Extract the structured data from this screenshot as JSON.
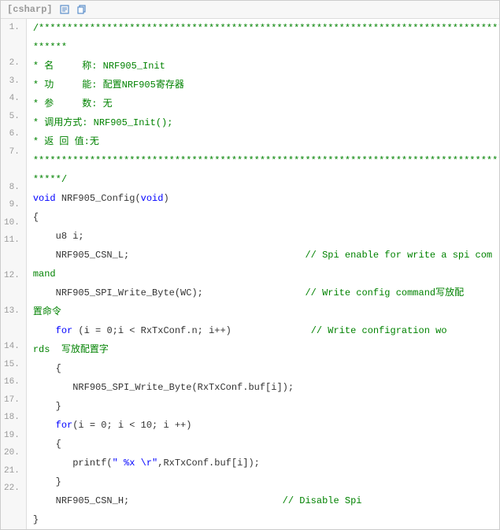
{
  "lang": "[csharp]",
  "icons": {
    "view": "view-plain-icon",
    "copy": "copy-icon"
  },
  "lines": [
    {
      "n": "1.",
      "segments": [
        {
          "cls": "c-comment",
          "t": "/************************************************************************************"
        }
      ]
    },
    {
      "cont": true,
      "segments": [
        {
          "cls": "c-comment",
          "t": "******"
        }
      ]
    },
    {
      "n": "2.",
      "segments": [
        {
          "cls": "c-comment",
          "t": "* 名     称: NRF905_Init"
        }
      ]
    },
    {
      "n": "3.",
      "segments": [
        {
          "cls": "c-comment",
          "t": "* 功     能: 配置NRF905寄存器"
        }
      ]
    },
    {
      "n": "4.",
      "segments": [
        {
          "cls": "c-comment",
          "t": "* 参     数: 无"
        }
      ]
    },
    {
      "n": "5.",
      "segments": [
        {
          "cls": "c-comment",
          "t": "* 调用方式: NRF905_Init();"
        }
      ]
    },
    {
      "n": "6.",
      "segments": [
        {
          "cls": "c-comment",
          "t": "* 返 回 值:无"
        }
      ]
    },
    {
      "n": "7.",
      "segments": [
        {
          "cls": "c-comment",
          "t": "*************************************************************************************"
        }
      ]
    },
    {
      "cont": true,
      "segments": [
        {
          "cls": "c-comment",
          "t": "*****/"
        }
      ]
    },
    {
      "n": "8.",
      "segments": [
        {
          "cls": "c-keyword",
          "t": "void"
        },
        {
          "t": " NRF905_Config("
        },
        {
          "cls": "c-keyword",
          "t": "void"
        },
        {
          "t": ")  "
        }
      ]
    },
    {
      "n": "9.",
      "segments": [
        {
          "t": "{  "
        }
      ]
    },
    {
      "n": "10.",
      "segments": [
        {
          "t": "    u8 i;  "
        }
      ]
    },
    {
      "n": "11.",
      "segments": [
        {
          "t": "    NRF905_CSN_L;                               "
        },
        {
          "cls": "c-comment",
          "t": "// Spi enable for write a spi com"
        }
      ]
    },
    {
      "cont": true,
      "segments": [
        {
          "cls": "c-comment",
          "t": "mand  "
        }
      ]
    },
    {
      "n": "12.",
      "segments": [
        {
          "t": "    NRF905_SPI_Write_Byte(WC);                  "
        },
        {
          "cls": "c-comment",
          "t": "// Write config command写放配"
        }
      ]
    },
    {
      "cont": true,
      "segments": [
        {
          "cls": "c-comment",
          "t": "置命令  "
        }
      ]
    },
    {
      "n": "13.",
      "segments": [
        {
          "t": "    "
        },
        {
          "cls": "c-keyword",
          "t": "for"
        },
        {
          "t": " (i = 0;i < RxTxConf.n; i++)              "
        },
        {
          "cls": "c-comment",
          "t": "// Write configration wo"
        }
      ]
    },
    {
      "cont": true,
      "segments": [
        {
          "cls": "c-comment",
          "t": "rds  写放配置字  "
        }
      ]
    },
    {
      "n": "14.",
      "segments": [
        {
          "t": "    {  "
        }
      ]
    },
    {
      "n": "15.",
      "segments": [
        {
          "t": "       NRF905_SPI_Write_Byte(RxTxConf.buf[i]);  "
        }
      ]
    },
    {
      "n": "16.",
      "segments": [
        {
          "t": "    }  "
        }
      ]
    },
    {
      "n": "17.",
      "segments": [
        {
          "t": "    "
        },
        {
          "cls": "c-keyword",
          "t": "for"
        },
        {
          "t": "(i = 0; i < 10; i ++)  "
        }
      ]
    },
    {
      "n": "18.",
      "segments": [
        {
          "t": "    {  "
        }
      ]
    },
    {
      "n": "19.",
      "segments": [
        {
          "t": "       printf("
        },
        {
          "cls": "c-string",
          "t": "\" %x \\r\""
        },
        {
          "t": ",RxTxConf.buf[i]);  "
        }
      ]
    },
    {
      "n": "20.",
      "segments": [
        {
          "t": "    }  "
        }
      ]
    },
    {
      "n": "21.",
      "segments": [
        {
          "t": "    NRF905_CSN_H;                           "
        },
        {
          "cls": "c-comment",
          "t": "// Disable Spi  "
        }
      ]
    },
    {
      "n": "22.",
      "segments": [
        {
          "t": "}  "
        }
      ]
    }
  ]
}
